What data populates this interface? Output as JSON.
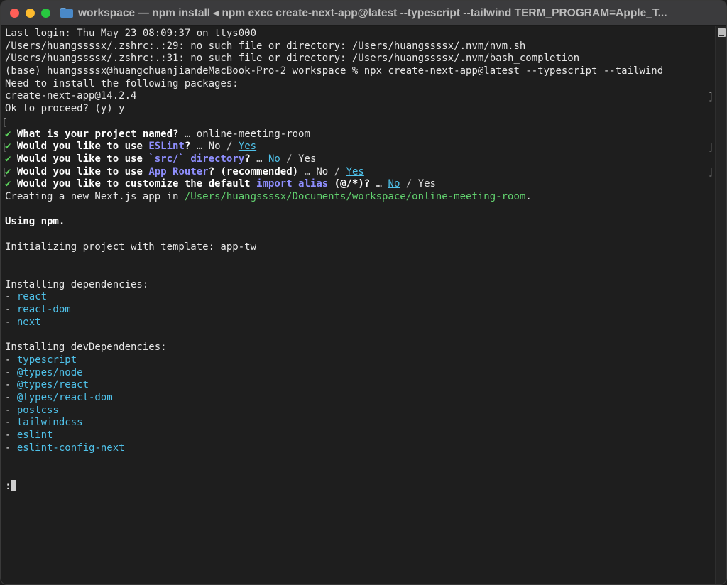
{
  "window": {
    "title": "workspace — npm install ◂ npm exec create-next-app@latest --typescript --tailwind TERM_PROGRAM=Apple_T..."
  },
  "terminal": {
    "line01": "Last login: Thu May 23 08:09:37 on ttys000",
    "line02": "/Users/huangssssx/.zshrc:.:29: no such file or directory: /Users/huangssssx/.nvm/nvm.sh",
    "line03": "/Users/huangssssx/.zshrc:.:31: no such file or directory: /Users/huangssssx/.nvm/bash_completion",
    "line04": "(base) huangssssx@huangchuanjiandeMacBook-Pro-2 workspace % npx create-next-app@latest --typescript --tailwind",
    "line05": "Need to install the following packages:",
    "line06": "create-next-app@14.2.4",
    "line07": "Ok to proceed? (y) y",
    "q1": {
      "check": "✔",
      "question": "What is your project named?",
      "sep": "…",
      "answer": "online-meeting-room"
    },
    "q2": {
      "check": "✔",
      "pre": "Would you like to use",
      "highlight": "ESLint",
      "post": "?",
      "sep": "…",
      "no": "No",
      "slash": "/",
      "yes": "Yes"
    },
    "q3": {
      "check": "✔",
      "pre": "Would you like to use",
      "highlight": "`src/` directory",
      "post": "?",
      "sep": "…",
      "no": "No",
      "slash": "/",
      "yes": "Yes"
    },
    "q4": {
      "check": "✔",
      "pre": "Would you like to use",
      "highlight": "App Router",
      "post": "? (recommended)",
      "sep": "…",
      "no": "No",
      "slash": "/",
      "yes": "Yes"
    },
    "q5": {
      "check": "✔",
      "pre": "Would you like to customize the default",
      "highlight": "import alias",
      "post": "(@/*)?",
      "sep": "…",
      "no": "No",
      "slash": "/",
      "yes": "Yes"
    },
    "creating_pre": "Creating a new Next.js app in",
    "creating_path": "/Users/huangssssx/Documents/workspace/online-meeting-room",
    "creating_post": ".",
    "using": "Using npm.",
    "initializing": "Initializing project with template: app-tw",
    "deps_header": "Installing dependencies:",
    "dependencies": [
      "react",
      "react-dom",
      "next"
    ],
    "devdeps_header": "Installing devDependencies:",
    "dev_dependencies": [
      "typescript",
      "@types/node",
      "@types/react",
      "@types/react-dom",
      "postcss",
      "tailwindcss",
      "eslint",
      "eslint-config-next"
    ],
    "bullet": "- ",
    "prompt": ":",
    "bracket_left": "[",
    "bracket_right": "]"
  },
  "colors": {
    "background": "#1e1e1e",
    "check": "#5fd75f",
    "highlight": "#8f8fff",
    "selected": "#4fc1e9",
    "path": "#62d26f"
  }
}
